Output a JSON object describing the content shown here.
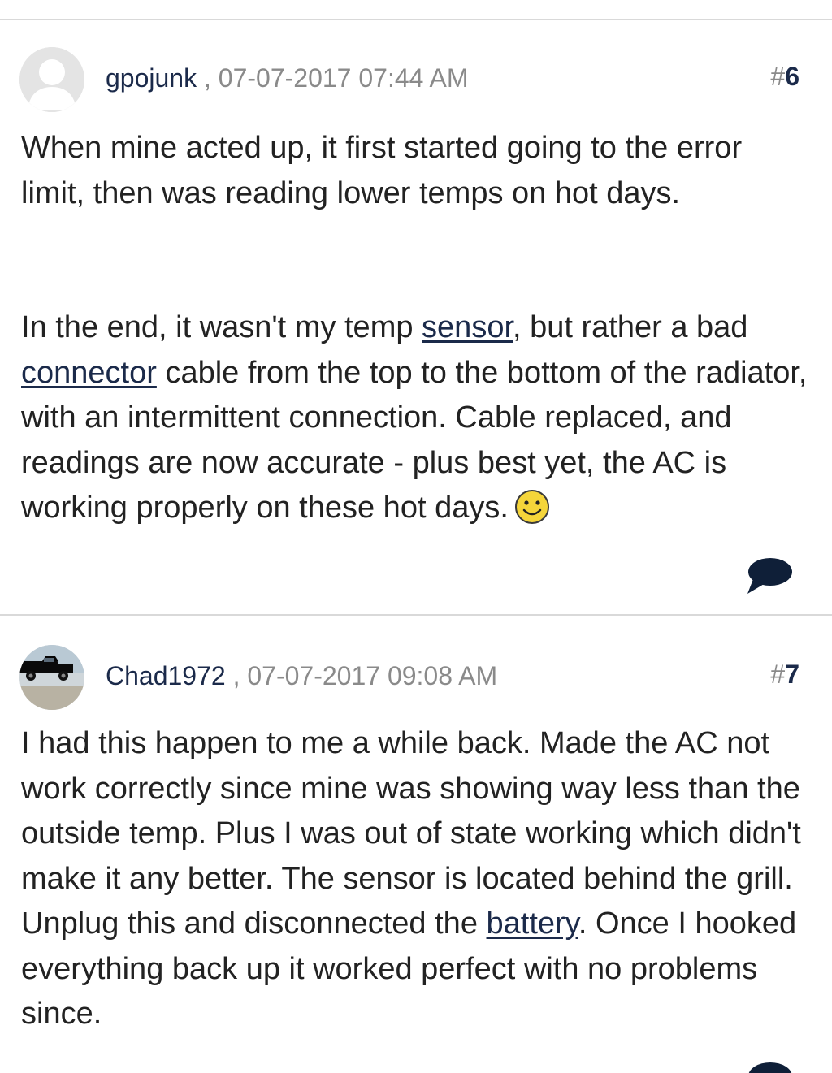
{
  "posts": [
    {
      "username": "gpojunk",
      "separator": ",",
      "date": "07-07-2017 07:44 AM",
      "post_prefix": "#",
      "post_number": "6",
      "paragraph1": "When mine acted up, it first started going to the error limit, then was reading lower temps on hot days.",
      "p2_text1": "In the end, it wasn't my temp ",
      "p2_link1": "sensor",
      "p2_text2": ", but rather a bad ",
      "p2_link2": "connector",
      "p2_text3": " cable from the top to the bottom of the radiator, with an intermittent connection. Cable replaced, and readings are now accurate - plus best yet, the AC is working properly on these hot days.",
      "avatar_icon": "default-user-icon",
      "smiley_icon": "smiley-face-icon",
      "reply_icon": "speech-bubble-icon"
    },
    {
      "username": "Chad1972",
      "separator": ",",
      "date": "07-07-2017 09:08 AM",
      "post_prefix": "#",
      "post_number": "7",
      "p1_text1": "I had this happen to me a while back. Made the AC not work correctly since mine was showing way less than the outside temp. Plus I was out of state working which didn't make it any better. The sensor is located behind the grill. Unplug this and disconnected the ",
      "p1_link1": "battery",
      "p1_text2": ". Once I hooked everything back up it worked perfect with no problems since.",
      "avatar_icon": "truck-photo-avatar",
      "reply_icon": "speech-bubble-icon"
    }
  ],
  "colors": {
    "username": "#1b2a4a",
    "meta_gray": "#8a8a8a",
    "body_text": "#222222",
    "divider": "#d9d9d9",
    "icon_dark": "#0f1f38"
  }
}
